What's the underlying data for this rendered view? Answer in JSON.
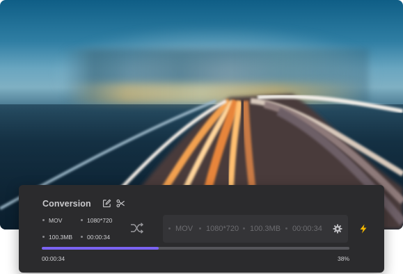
{
  "panel": {
    "title": "Conversion",
    "source": {
      "format": "MOV",
      "resolution": "1080*720",
      "size": "100.3MB",
      "duration": "00:00:34"
    },
    "output": {
      "format": "MOV",
      "resolution": "1080*720",
      "size": "100.3MB",
      "duration": "00:00:34"
    },
    "progress": {
      "fraction": 0.38,
      "elapsed": "00:00:34",
      "percent_label": "38%"
    },
    "icons": {
      "edit": "edit-icon",
      "cut": "scissors-icon",
      "convert": "shuffle-icon",
      "settings": "gear-icon",
      "accelerate": "lightning-icon"
    },
    "colors": {
      "panel_bg": "#2b2b2d",
      "progress_fill": "#7b63f2",
      "lightning": "#f5b800"
    }
  }
}
